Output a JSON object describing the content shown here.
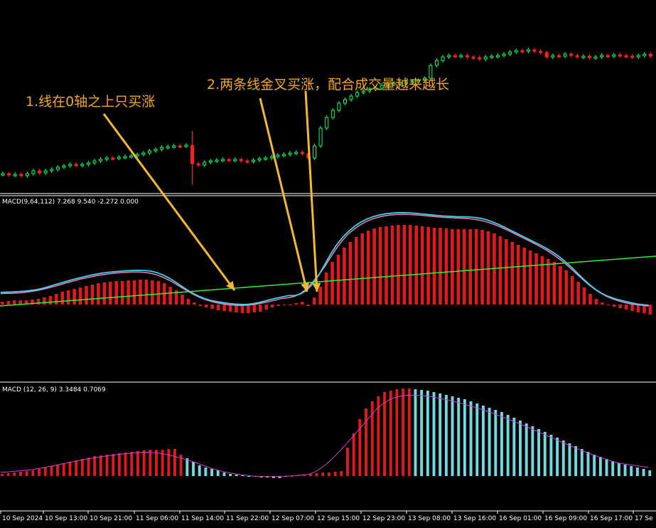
{
  "annotations": {
    "note1": "1.线在0轴之上只买涨",
    "note2": "2.两条线金叉买涨，配合成交量越来越长"
  },
  "indicator1": {
    "label": "MACD(9,64,112) 7.268 9.540 -2.272 0.000"
  },
  "indicator2": {
    "label": "MACD (12, 26, 9)  3.3484  0.7069"
  },
  "time_axis": [
    "10 Sep 2024",
    "10 Sep 13:00",
    "10 Sep 21:00",
    "11 Sep 06:00",
    "11 Sep 14:00",
    "11 Sep 22:00",
    "12 Sep 07:00",
    "12 Sep 15:00",
    "12 Sep 23:00",
    "13 Sep 08:00",
    "13 Sep 16:00",
    "16 Sep 01:00",
    "16 Sep 09:00",
    "16 Sep 17:00",
    "17 Se"
  ],
  "colors": {
    "background": "#000000",
    "bull_candle": "#00ff66",
    "bear_candle": "#ff2020",
    "histogram_red": "#e01a1a",
    "histogram_cyan": "#6fd8e0",
    "histogram_green": "#33ff33",
    "macd_line_cyan": "#40d0f0",
    "signal_line_pink": "#f080c0",
    "slow_line_green": "#33ee33",
    "signal_line_magenta": "#d040d0",
    "annotation_arrow": "#f5b830",
    "separator": "#ffffff"
  },
  "chart_data": [
    {
      "type": "candlestick",
      "description_source": "price pane",
      "close": [
        244,
        246,
        245,
        247,
        244,
        240,
        243,
        240,
        238,
        235,
        233,
        231,
        232,
        231,
        229,
        226,
        224,
        222,
        222,
        221,
        220,
        219,
        217,
        215,
        212,
        210,
        207,
        206,
        205,
        205,
        204,
        230,
        232,
        228,
        226,
        225,
        224,
        225,
        224,
        226,
        227,
        225,
        223,
        222,
        220,
        218,
        217,
        215,
        214,
        216,
        222,
        205,
        180,
        165,
        155,
        145,
        140,
        135,
        130,
        128,
        125,
        124,
        120,
        118,
        117,
        116,
        115,
        114,
        113,
        110,
        92,
        85,
        80,
        78,
        79,
        78,
        80,
        81,
        83,
        80,
        79,
        78,
        76,
        73,
        71,
        72,
        70,
        72,
        74,
        80,
        78,
        79,
        76,
        78,
        80,
        79,
        81,
        80,
        78,
        79,
        77,
        78,
        79,
        80,
        78,
        76,
        79
      ]
    },
    {
      "type": "bar+line",
      "name": "MACD(9,64,112)",
      "histogram": [
        4,
        5,
        6,
        6,
        6,
        7,
        8,
        10,
        12,
        15,
        18,
        20,
        22,
        24,
        26,
        28,
        30,
        31,
        32,
        33,
        33,
        34,
        34,
        35,
        35,
        34,
        33,
        30,
        25,
        20,
        14,
        8,
        3,
        -2,
        -4,
        -6,
        -8,
        -9,
        -10,
        -11,
        -12,
        -12,
        -11,
        -10,
        -7,
        -4,
        -2,
        -1,
        0,
        2,
        4,
        -2,
        10,
        25,
        45,
        60,
        70,
        80,
        88,
        95,
        100,
        104,
        107,
        109,
        110,
        111,
        112,
        112,
        112,
        111,
        110,
        109,
        108,
        108,
        107,
        106,
        106,
        106,
        106,
        106,
        105,
        103,
        100,
        96,
        92,
        88,
        84,
        80,
        76,
        72,
        68,
        64,
        60,
        54,
        48,
        40,
        32,
        24,
        15,
        8,
        3,
        -1,
        -3,
        -5,
        -7,
        -9,
        -11,
        -12,
        -14
      ]
    },
    {
      "type": "bar+line",
      "name": "MACD (12, 26, 9)",
      "histogram": [
        3,
        4,
        5,
        6,
        7,
        8,
        10,
        12,
        14,
        16,
        18,
        20,
        22,
        24,
        26,
        28,
        29,
        30,
        31,
        32,
        33,
        34,
        35,
        36,
        37,
        37,
        37,
        38,
        38,
        30,
        25,
        20,
        15,
        12,
        10,
        8,
        5,
        3,
        2,
        1,
        0,
        -1,
        -2,
        -2,
        -3,
        -3,
        -1,
        0,
        1,
        2,
        3,
        4,
        5,
        5,
        6,
        7,
        40,
        60,
        80,
        95,
        105,
        112,
        118,
        120,
        122,
        123,
        123,
        122,
        121,
        120,
        118,
        116,
        114,
        112,
        110,
        108,
        105,
        102,
        99,
        96,
        93,
        90,
        86,
        82,
        78,
        74,
        70,
        66,
        62,
        58,
        54,
        50,
        46,
        42,
        38,
        34,
        30,
        27,
        24,
        21,
        18,
        16,
        14,
        12,
        10,
        8
      ]
    }
  ]
}
